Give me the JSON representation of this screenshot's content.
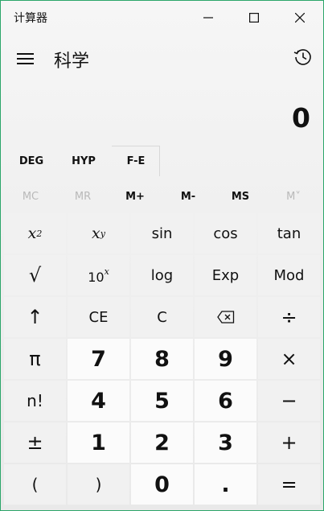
{
  "window": {
    "title": "计算器",
    "minimize_icon": "—",
    "maximize_icon": "☐",
    "close_icon": "✕"
  },
  "header": {
    "mode_title": "科学"
  },
  "display": {
    "value": "0"
  },
  "angle_row": {
    "deg": "DEG",
    "hyp": "HYP",
    "fe": "F-E"
  },
  "memory": {
    "mc": "MC",
    "mr": "MR",
    "mplus": "M+",
    "mminus": "M-",
    "ms": "MS",
    "mlist": "M˅"
  },
  "keys": {
    "sin": "sin",
    "cos": "cos",
    "tan": "tan",
    "sqrt": "√",
    "log": "log",
    "exp": "Exp",
    "mod": "Mod",
    "shift": "↑",
    "ce": "CE",
    "c": "C",
    "divide": "÷",
    "pi": "π",
    "seven": "7",
    "eight": "8",
    "nine": "9",
    "multiply": "×",
    "factorial": "n!",
    "four": "4",
    "five": "5",
    "six": "6",
    "minus": "−",
    "negate": "±",
    "one": "1",
    "two": "2",
    "three": "3",
    "plus": "+",
    "lparen": "(",
    "rparen": ")",
    "zero": "0",
    "dot": ".",
    "equals": "="
  },
  "icons": {
    "hamburger": "menu-icon",
    "history": "history-icon",
    "backspace": "backspace-icon"
  },
  "colors": {
    "window_border": "#2ca66a",
    "number_key_bg": "#fbfbfb",
    "function_key_bg": "#f1f1f1",
    "disabled_text": "#b9b9b9"
  }
}
